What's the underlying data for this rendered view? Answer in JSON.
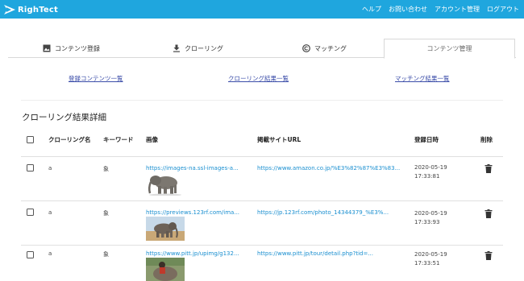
{
  "header": {
    "brand": "RighTect",
    "nav": [
      "ヘルプ",
      "お問い合わせ",
      "アカウント管理",
      "ログアウト"
    ],
    "colors": {
      "bar": "#1fa6de"
    }
  },
  "tabs": [
    {
      "label": "コンテンツ登録",
      "icon": "image-icon"
    },
    {
      "label": "クローリング",
      "icon": "download-icon"
    },
    {
      "label": "マッチング",
      "icon": "copyright-icon"
    },
    {
      "label": "コンテンツ管理",
      "icon": "",
      "active": true
    }
  ],
  "sublinks": [
    "登録コンテンツ一覧",
    "クローリング結果一覧",
    "マッチング結果一覧"
  ],
  "section_title": "クローリング結果詳細",
  "table": {
    "headers": {
      "name": "クローリング名",
      "keyword": "キーワード",
      "image": "画像",
      "site_url": "掲載サイトURL",
      "date": "登録日時",
      "delete": "削除"
    },
    "rows": [
      {
        "name": "a",
        "keyword": "象",
        "image_url": "https://images-na.ssl-images-a...",
        "site_url": "https://www.amazon.co.jp/%E3%82%87%E3%83...",
        "date": "2020-05-19",
        "time": "17:33:81"
      },
      {
        "name": "a",
        "keyword": "象",
        "image_url": "https://previews.123rf.com/ima...",
        "site_url": "https://jp.123rf.com/photo_14344379_%E3%...",
        "date": "2020-05-19",
        "time": "17:33:93"
      },
      {
        "name": "a",
        "keyword": "象",
        "image_url": "https://www.pitt.jp/upimg/g132...",
        "site_url": "https://www.pitt.jp/tour/detail.php?tid=...",
        "date": "2020-05-19",
        "time": "17:33:51"
      }
    ]
  }
}
